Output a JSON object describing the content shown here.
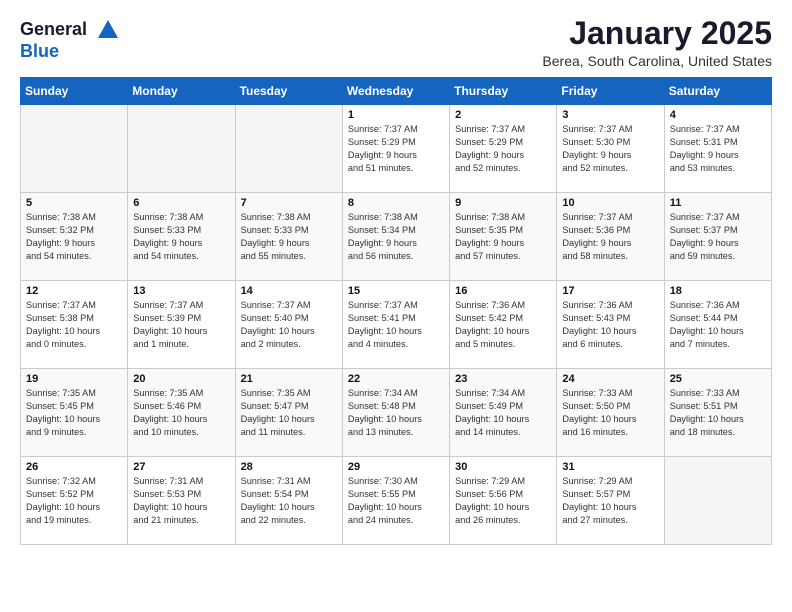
{
  "header": {
    "logo_line1": "General",
    "logo_line2": "Blue",
    "month_year": "January 2025",
    "location": "Berea, South Carolina, United States"
  },
  "weekdays": [
    "Sunday",
    "Monday",
    "Tuesday",
    "Wednesday",
    "Thursday",
    "Friday",
    "Saturday"
  ],
  "weeks": [
    [
      {
        "day": "",
        "info": ""
      },
      {
        "day": "",
        "info": ""
      },
      {
        "day": "",
        "info": ""
      },
      {
        "day": "1",
        "info": "Sunrise: 7:37 AM\nSunset: 5:29 PM\nDaylight: 9 hours\nand 51 minutes."
      },
      {
        "day": "2",
        "info": "Sunrise: 7:37 AM\nSunset: 5:29 PM\nDaylight: 9 hours\nand 52 minutes."
      },
      {
        "day": "3",
        "info": "Sunrise: 7:37 AM\nSunset: 5:30 PM\nDaylight: 9 hours\nand 52 minutes."
      },
      {
        "day": "4",
        "info": "Sunrise: 7:37 AM\nSunset: 5:31 PM\nDaylight: 9 hours\nand 53 minutes."
      }
    ],
    [
      {
        "day": "5",
        "info": "Sunrise: 7:38 AM\nSunset: 5:32 PM\nDaylight: 9 hours\nand 54 minutes."
      },
      {
        "day": "6",
        "info": "Sunrise: 7:38 AM\nSunset: 5:33 PM\nDaylight: 9 hours\nand 54 minutes."
      },
      {
        "day": "7",
        "info": "Sunrise: 7:38 AM\nSunset: 5:33 PM\nDaylight: 9 hours\nand 55 minutes."
      },
      {
        "day": "8",
        "info": "Sunrise: 7:38 AM\nSunset: 5:34 PM\nDaylight: 9 hours\nand 56 minutes."
      },
      {
        "day": "9",
        "info": "Sunrise: 7:38 AM\nSunset: 5:35 PM\nDaylight: 9 hours\nand 57 minutes."
      },
      {
        "day": "10",
        "info": "Sunrise: 7:37 AM\nSunset: 5:36 PM\nDaylight: 9 hours\nand 58 minutes."
      },
      {
        "day": "11",
        "info": "Sunrise: 7:37 AM\nSunset: 5:37 PM\nDaylight: 9 hours\nand 59 minutes."
      }
    ],
    [
      {
        "day": "12",
        "info": "Sunrise: 7:37 AM\nSunset: 5:38 PM\nDaylight: 10 hours\nand 0 minutes."
      },
      {
        "day": "13",
        "info": "Sunrise: 7:37 AM\nSunset: 5:39 PM\nDaylight: 10 hours\nand 1 minute."
      },
      {
        "day": "14",
        "info": "Sunrise: 7:37 AM\nSunset: 5:40 PM\nDaylight: 10 hours\nand 2 minutes."
      },
      {
        "day": "15",
        "info": "Sunrise: 7:37 AM\nSunset: 5:41 PM\nDaylight: 10 hours\nand 4 minutes."
      },
      {
        "day": "16",
        "info": "Sunrise: 7:36 AM\nSunset: 5:42 PM\nDaylight: 10 hours\nand 5 minutes."
      },
      {
        "day": "17",
        "info": "Sunrise: 7:36 AM\nSunset: 5:43 PM\nDaylight: 10 hours\nand 6 minutes."
      },
      {
        "day": "18",
        "info": "Sunrise: 7:36 AM\nSunset: 5:44 PM\nDaylight: 10 hours\nand 7 minutes."
      }
    ],
    [
      {
        "day": "19",
        "info": "Sunrise: 7:35 AM\nSunset: 5:45 PM\nDaylight: 10 hours\nand 9 minutes."
      },
      {
        "day": "20",
        "info": "Sunrise: 7:35 AM\nSunset: 5:46 PM\nDaylight: 10 hours\nand 10 minutes."
      },
      {
        "day": "21",
        "info": "Sunrise: 7:35 AM\nSunset: 5:47 PM\nDaylight: 10 hours\nand 11 minutes."
      },
      {
        "day": "22",
        "info": "Sunrise: 7:34 AM\nSunset: 5:48 PM\nDaylight: 10 hours\nand 13 minutes."
      },
      {
        "day": "23",
        "info": "Sunrise: 7:34 AM\nSunset: 5:49 PM\nDaylight: 10 hours\nand 14 minutes."
      },
      {
        "day": "24",
        "info": "Sunrise: 7:33 AM\nSunset: 5:50 PM\nDaylight: 10 hours\nand 16 minutes."
      },
      {
        "day": "25",
        "info": "Sunrise: 7:33 AM\nSunset: 5:51 PM\nDaylight: 10 hours\nand 18 minutes."
      }
    ],
    [
      {
        "day": "26",
        "info": "Sunrise: 7:32 AM\nSunset: 5:52 PM\nDaylight: 10 hours\nand 19 minutes."
      },
      {
        "day": "27",
        "info": "Sunrise: 7:31 AM\nSunset: 5:53 PM\nDaylight: 10 hours\nand 21 minutes."
      },
      {
        "day": "28",
        "info": "Sunrise: 7:31 AM\nSunset: 5:54 PM\nDaylight: 10 hours\nand 22 minutes."
      },
      {
        "day": "29",
        "info": "Sunrise: 7:30 AM\nSunset: 5:55 PM\nDaylight: 10 hours\nand 24 minutes."
      },
      {
        "day": "30",
        "info": "Sunrise: 7:29 AM\nSunset: 5:56 PM\nDaylight: 10 hours\nand 26 minutes."
      },
      {
        "day": "31",
        "info": "Sunrise: 7:29 AM\nSunset: 5:57 PM\nDaylight: 10 hours\nand 27 minutes."
      },
      {
        "day": "",
        "info": ""
      }
    ]
  ]
}
